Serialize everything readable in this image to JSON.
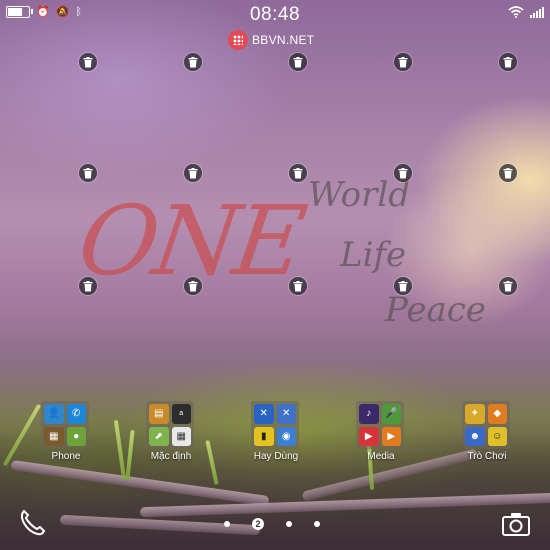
{
  "status_bar": {
    "time": "08:48",
    "battery_level": 0.7,
    "left_icons": [
      "battery-icon",
      "alarm-icon",
      "notifications-muted-icon",
      "bluetooth-icon"
    ],
    "right_icons": [
      "wifi-icon",
      "cellular-signal-icon"
    ]
  },
  "brand": {
    "text": "BBVN.NET",
    "color": "#e24b55"
  },
  "watermark": {
    "main": "ONE",
    "words": [
      "World",
      "Life",
      "Peace"
    ],
    "main_color": "#cd4646"
  },
  "folders": [
    {
      "label": "Phone",
      "apps": [
        {
          "icon": "contacts-icon",
          "color": "#2f86c9"
        },
        {
          "icon": "call-log-icon",
          "color": "#1d86d6"
        },
        {
          "icon": "bbm-icon",
          "color": "#7a5a2b"
        },
        {
          "icon": "remember-icon",
          "color": "#6fa33a"
        }
      ]
    },
    {
      "label": "Mặc định",
      "apps": [
        {
          "icon": "store-icon",
          "color": "#c98b2a"
        },
        {
          "icon": "amazon-icon",
          "color": "#2d2d2d"
        },
        {
          "icon": "maps-icon",
          "color": "#7fb34d"
        },
        {
          "icon": "calendar-icon",
          "color": "#e8e8e8"
        }
      ]
    },
    {
      "label": "Hay Dùng",
      "apps": [
        {
          "icon": "tools-icon",
          "color": "#2a64c2"
        },
        {
          "icon": "settings-tools-icon",
          "color": "#3f72c7"
        },
        {
          "icon": "docs-to-go-icon",
          "color": "#e3c31f"
        },
        {
          "icon": "data-icon",
          "color": "#3a7fd1"
        }
      ]
    },
    {
      "label": "Media",
      "apps": [
        {
          "icon": "music-icon",
          "color": "#3a2a6a"
        },
        {
          "icon": "voice-icon",
          "color": "#4e9a3a"
        },
        {
          "icon": "video-icon",
          "color": "#d7343a"
        },
        {
          "icon": "play-icon",
          "color": "#e07b20"
        }
      ]
    },
    {
      "label": "Trò Chơi",
      "apps": [
        {
          "icon": "game-a-icon",
          "color": "#d8a92a"
        },
        {
          "icon": "game-b-icon",
          "color": "#e07b20"
        },
        {
          "icon": "game-c-icon",
          "color": "#3a6ac8"
        },
        {
          "icon": "game-d-icon",
          "color": "#e0c02a"
        }
      ]
    }
  ],
  "pager": {
    "current_page": "2",
    "page_count": 4
  },
  "dock": {
    "left": "phone-icon",
    "right": "camera-icon"
  }
}
